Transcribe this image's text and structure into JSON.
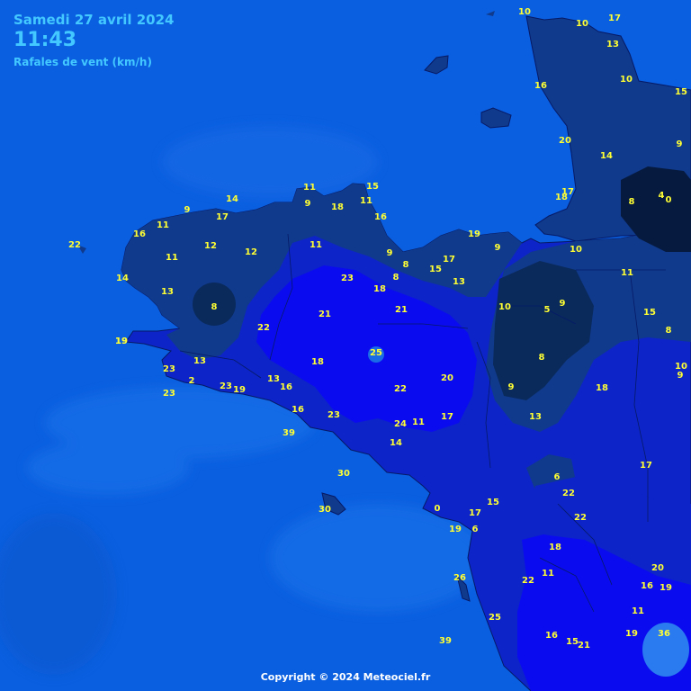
{
  "header": {
    "date": "Samedi 27 avril 2024",
    "time": "11:43",
    "parameter": "Rafales de vent (km/h)"
  },
  "footer": {
    "copyright": "Copyright © 2024 Meteociel.fr"
  },
  "colors": {
    "sea": "#0a5fe0",
    "value_text": "#ffff33",
    "header_text": "#43c9ff",
    "land_weak": "#103a8c",
    "land_moderate": "#0d24c8",
    "land_strong": "#0b0bf0",
    "land_very_weak": "#0a2a5c"
  },
  "observations": [
    "10",
    "10",
    "17",
    "13",
    "10",
    "15",
    "16",
    "9",
    "20",
    "14",
    "8",
    "4",
    "0",
    "17",
    "18",
    "11",
    "14",
    "9",
    "11",
    "9",
    "11",
    "15",
    "16",
    "18",
    "17",
    "16",
    "11",
    "12",
    "12",
    "22",
    "14",
    "11",
    "13",
    "8",
    "19",
    "9",
    "8",
    "19",
    "17",
    "9",
    "15",
    "13",
    "10",
    "10",
    "11",
    "23",
    "18",
    "8",
    "21",
    "21",
    "5",
    "9",
    "15",
    "8",
    "22",
    "19",
    "13",
    "23",
    "25",
    "18",
    "8",
    "10",
    "9",
    "23",
    "2",
    "23",
    "19",
    "13",
    "16",
    "22",
    "20",
    "9",
    "18",
    "13",
    "16",
    "23",
    "17",
    "39",
    "24",
    "11",
    "14",
    "17",
    "30",
    "6",
    "22",
    "15",
    "0",
    "17",
    "22",
    "30",
    "19",
    "6",
    "18",
    "11",
    "20",
    "22",
    "16",
    "19",
    "26",
    "11",
    "25",
    "36",
    "16",
    "15",
    "21",
    "39",
    "19"
  ]
}
